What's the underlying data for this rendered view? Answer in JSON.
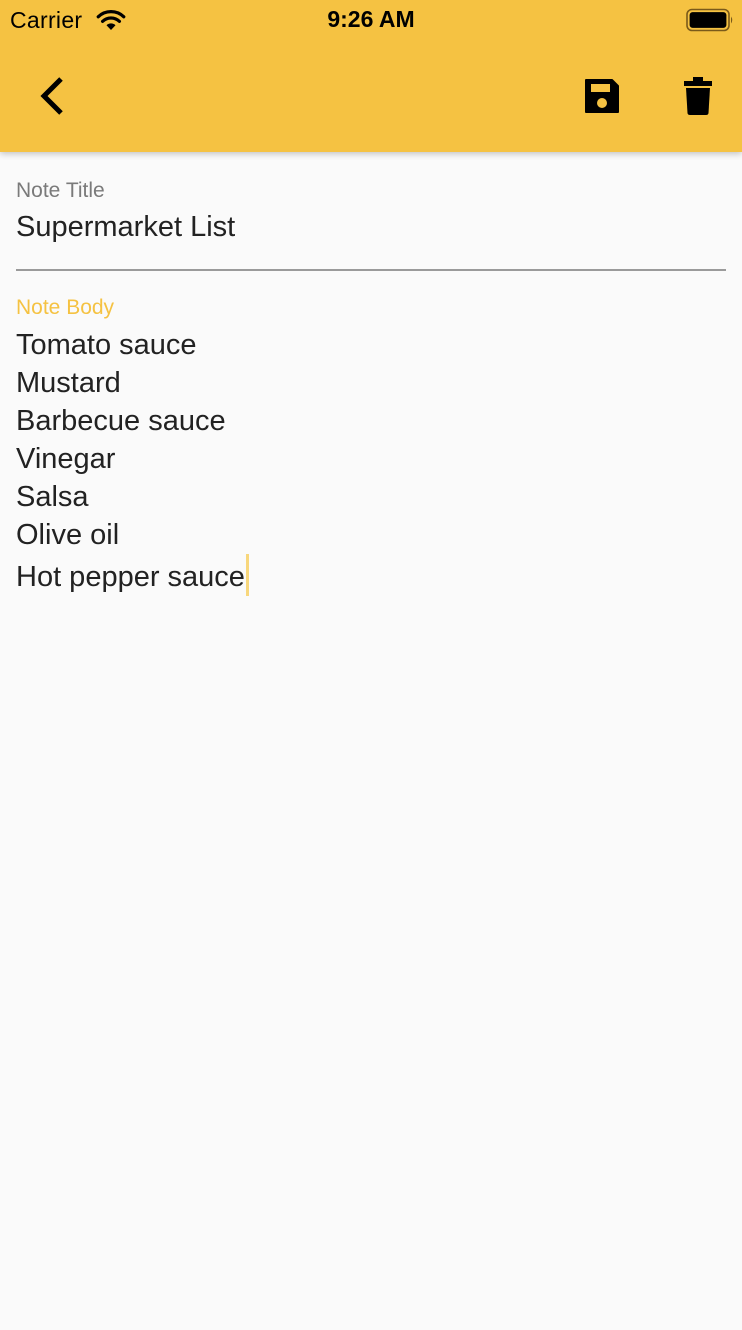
{
  "status_bar": {
    "carrier": "Carrier",
    "time": "9:26 AM",
    "wifi_icon": "wifi-icon",
    "battery_icon": "battery-icon"
  },
  "toolbar": {
    "background_color": "#f5c242",
    "back_icon": "chevron-left-icon",
    "save_icon": "save-icon",
    "delete_icon": "trash-icon"
  },
  "form": {
    "title_label": "Note Title",
    "title_value": "Supermarket List",
    "body_label": "Note Body",
    "body_label_color": "#f5c242",
    "body_lines": [
      "Tomato sauce",
      "Mustard",
      "Barbecue sauce",
      "Vinegar",
      "Salsa",
      "Olive oil",
      "Hot pepper sauce"
    ]
  }
}
